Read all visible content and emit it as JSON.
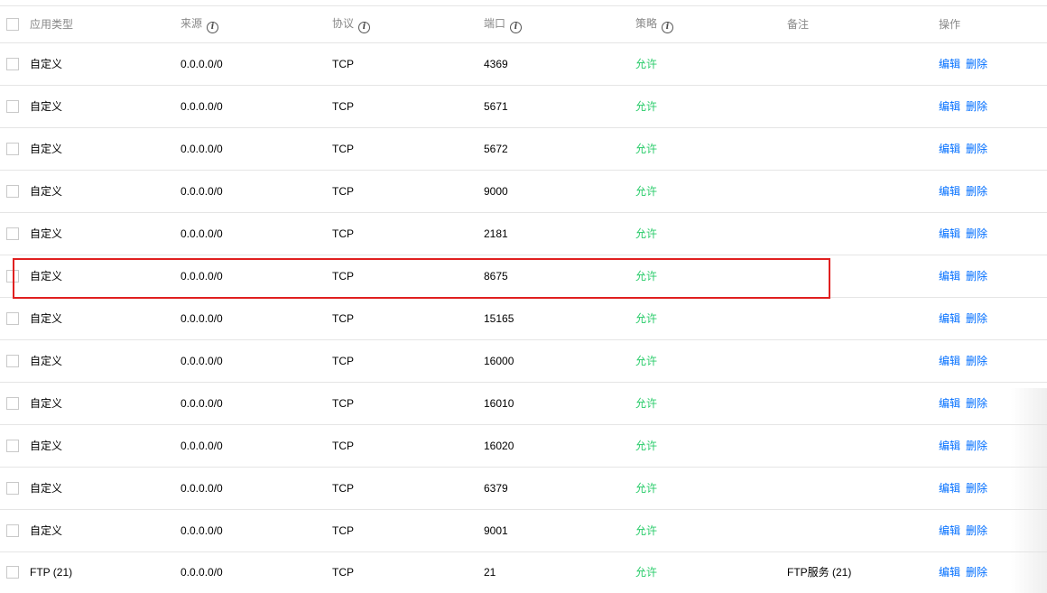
{
  "table": {
    "columns": [
      {
        "label": "应用类型",
        "info": false
      },
      {
        "label": "来源",
        "info": true
      },
      {
        "label": "协议",
        "info": true
      },
      {
        "label": "端口",
        "info": true
      },
      {
        "label": "策略",
        "info": true
      },
      {
        "label": "备注",
        "info": false
      },
      {
        "label": "操作",
        "info": false
      }
    ],
    "rows": [
      {
        "type": "自定义",
        "source": "0.0.0.0/0",
        "protocol": "TCP",
        "port": "4369",
        "policy": "允许",
        "note": "",
        "edit": "编辑",
        "delete": "删除"
      },
      {
        "type": "自定义",
        "source": "0.0.0.0/0",
        "protocol": "TCP",
        "port": "5671",
        "policy": "允许",
        "note": "",
        "edit": "编辑",
        "delete": "删除"
      },
      {
        "type": "自定义",
        "source": "0.0.0.0/0",
        "protocol": "TCP",
        "port": "5672",
        "policy": "允许",
        "note": "",
        "edit": "编辑",
        "delete": "删除"
      },
      {
        "type": "自定义",
        "source": "0.0.0.0/0",
        "protocol": "TCP",
        "port": "9000",
        "policy": "允许",
        "note": "",
        "edit": "编辑",
        "delete": "删除"
      },
      {
        "type": "自定义",
        "source": "0.0.0.0/0",
        "protocol": "TCP",
        "port": "2181",
        "policy": "允许",
        "note": "",
        "edit": "编辑",
        "delete": "删除"
      },
      {
        "type": "自定义",
        "source": "0.0.0.0/0",
        "protocol": "TCP",
        "port": "8675",
        "policy": "允许",
        "note": "",
        "edit": "编辑",
        "delete": "删除",
        "highlighted": true
      },
      {
        "type": "自定义",
        "source": "0.0.0.0/0",
        "protocol": "TCP",
        "port": "15165",
        "policy": "允许",
        "note": "",
        "edit": "编辑",
        "delete": "删除"
      },
      {
        "type": "自定义",
        "source": "0.0.0.0/0",
        "protocol": "TCP",
        "port": "16000",
        "policy": "允许",
        "note": "",
        "edit": "编辑",
        "delete": "删除"
      },
      {
        "type": "自定义",
        "source": "0.0.0.0/0",
        "protocol": "TCP",
        "port": "16010",
        "policy": "允许",
        "note": "",
        "edit": "编辑",
        "delete": "删除"
      },
      {
        "type": "自定义",
        "source": "0.0.0.0/0",
        "protocol": "TCP",
        "port": "16020",
        "policy": "允许",
        "note": "",
        "edit": "编辑",
        "delete": "删除"
      },
      {
        "type": "自定义",
        "source": "0.0.0.0/0",
        "protocol": "TCP",
        "port": "6379",
        "policy": "允许",
        "note": "",
        "edit": "编辑",
        "delete": "删除"
      },
      {
        "type": "自定义",
        "source": "0.0.0.0/0",
        "protocol": "TCP",
        "port": "9001",
        "policy": "允许",
        "note": "",
        "edit": "编辑",
        "delete": "删除"
      },
      {
        "type": "FTP (21)",
        "source": "0.0.0.0/0",
        "protocol": "TCP",
        "port": "21",
        "policy": "允许",
        "note": "FTP服务 (21)",
        "edit": "编辑",
        "delete": "删除"
      }
    ]
  },
  "icons": {
    "info": "info-circle-icon",
    "checkbox": "checkbox-unchecked"
  },
  "colors": {
    "allow": "#29cc6a",
    "link": "#006eff",
    "highlight": "#e02020",
    "header_text": "#888888",
    "border": "#e5e5e5"
  }
}
